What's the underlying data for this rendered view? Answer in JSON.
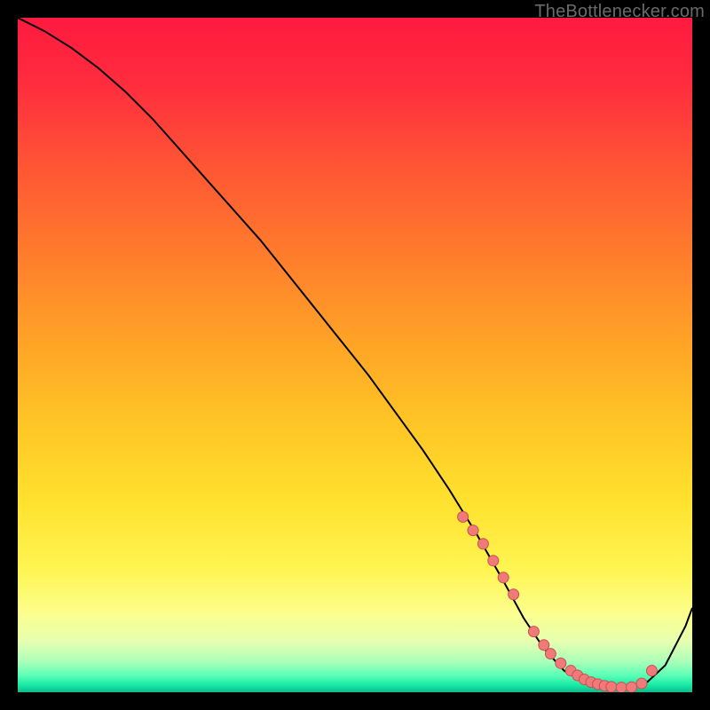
{
  "watermark": "TheBottlenecker.com",
  "colors": {
    "gradient_stops": [
      {
        "offset": 0.0,
        "color": "#ff1a3f"
      },
      {
        "offset": 0.1,
        "color": "#ff2d3e"
      },
      {
        "offset": 0.22,
        "color": "#ff5534"
      },
      {
        "offset": 0.35,
        "color": "#ff7c2c"
      },
      {
        "offset": 0.48,
        "color": "#ffa326"
      },
      {
        "offset": 0.6,
        "color": "#ffc525"
      },
      {
        "offset": 0.72,
        "color": "#ffe22f"
      },
      {
        "offset": 0.82,
        "color": "#fff553"
      },
      {
        "offset": 0.885,
        "color": "#fbff8f"
      },
      {
        "offset": 0.925,
        "color": "#e6ffb0"
      },
      {
        "offset": 0.955,
        "color": "#a9ffb9"
      },
      {
        "offset": 0.975,
        "color": "#5bffb6"
      },
      {
        "offset": 0.99,
        "color": "#15e9a6"
      },
      {
        "offset": 1.0,
        "color": "#0fb98a"
      }
    ],
    "curve": "#000000",
    "dot_fill": "#f07a7a",
    "dot_stroke": "#c94f4f"
  },
  "chart_data": {
    "type": "line",
    "title": "",
    "xlabel": "",
    "ylabel": "",
    "xlim": [
      0,
      100
    ],
    "ylim": [
      0,
      100
    ],
    "grid": false,
    "legend": false,
    "series": [
      {
        "name": "bottleneck-curve",
        "x": [
          0,
          4,
          8,
          12,
          16,
          20,
          28,
          36,
          44,
          52,
          60,
          64,
          68,
          72,
          75,
          78,
          81,
          84,
          87,
          90,
          93,
          96,
          99,
          100
        ],
        "y": [
          100,
          98,
          95.5,
          92.5,
          89,
          85,
          76,
          67,
          57,
          47,
          36,
          30,
          23.5,
          16.5,
          11,
          6.5,
          3.2,
          1.4,
          0.6,
          0.5,
          1.2,
          4.0,
          9.8,
          12.5
        ]
      }
    ],
    "points": {
      "name": "highlight-dots",
      "x": [
        66,
        67.5,
        69,
        70.5,
        72,
        73.5,
        76.5,
        78,
        79,
        80.5,
        82,
        83,
        84,
        85,
        86,
        87,
        88,
        89.5,
        91,
        92.5,
        94
      ],
      "y": [
        26,
        24,
        22,
        19.5,
        17,
        14.5,
        9,
        7,
        5.7,
        4.3,
        3.2,
        2.5,
        1.9,
        1.5,
        1.2,
        0.95,
        0.8,
        0.7,
        0.75,
        1.3,
        3.2
      ]
    }
  }
}
